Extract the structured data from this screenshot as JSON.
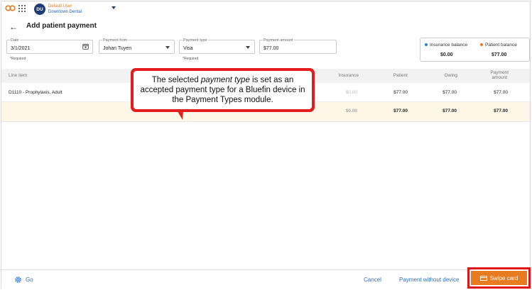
{
  "topbar": {
    "avatar_initials": "DU",
    "user_name": "Default User",
    "location": "Downtown Dental"
  },
  "header": {
    "title": "Add patient payment"
  },
  "form": {
    "date": {
      "label": "Date",
      "value": "3/1/2021",
      "required_note": "*Required"
    },
    "payment_from": {
      "label": "Payment from",
      "value": "Johan Tuyen"
    },
    "payment_type": {
      "label": "Payment type",
      "value": "Visa",
      "required_note": "*Required"
    },
    "payment_amount": {
      "label": "Payment amount",
      "value": "$77.00"
    }
  },
  "balances": {
    "insurance": {
      "label": "Insurance balance",
      "value": "$0.00",
      "color": "#2a7de1"
    },
    "patient": {
      "label": "Patient balance",
      "value": "$77.00",
      "color": "#e87a1f"
    }
  },
  "table": {
    "columns": [
      "Line item",
      "Insurance",
      "Patient",
      "Owing",
      "Payment",
      "amount"
    ],
    "rows": [
      {
        "line_item": "D1110 - Prophylaxis, Adult",
        "insurance": "$0.00",
        "patient": "$77.00",
        "owing": "$77.00",
        "payment_amount": "$77.00"
      }
    ],
    "totals": {
      "insurance": "$0.00",
      "patient": "$77.00",
      "owing": "$77.00",
      "payment_amount": "$77.00"
    }
  },
  "callout": {
    "before": "The selected ",
    "emphasis": "payment type",
    "after": " is set as an accepted payment type for a Bluefin device in the Payment Types module."
  },
  "footer": {
    "go_label": "Go",
    "cancel_label": "Cancel",
    "without_device_label": "Payment without device",
    "swipe_label": "Swipe card"
  },
  "colors": {
    "accent": "#e87a1f",
    "link": "#2a6fc7",
    "highlight": "#e01515"
  }
}
